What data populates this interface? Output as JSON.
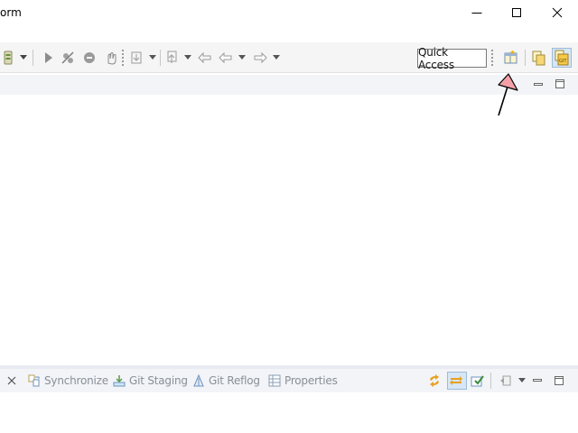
{
  "window": {
    "title": "orm",
    "controls": [
      "minimize",
      "maximize",
      "close"
    ]
  },
  "toolbar": {
    "quick_access_label": "Quick Access",
    "icons": [
      "open-task-icon",
      "run-icon",
      "skip-breakpoints-icon",
      "terminate-icon",
      "drop-to-frame-icon",
      "step-into-icon",
      "next-annotation-icon",
      "last-edit-location-icon",
      "back-icon",
      "forward-icon",
      "open-perspective-icon",
      "java-perspective-icon",
      "git-perspective-icon"
    ]
  },
  "bottom_panel": {
    "tabs": [
      {
        "label": "Synchronize"
      },
      {
        "label": "Git Staging"
      },
      {
        "label": "Git Reflog"
      },
      {
        "label": "Properties"
      }
    ]
  },
  "annotation": {
    "target": "open-perspective-button",
    "color": "#f4a0a8"
  }
}
